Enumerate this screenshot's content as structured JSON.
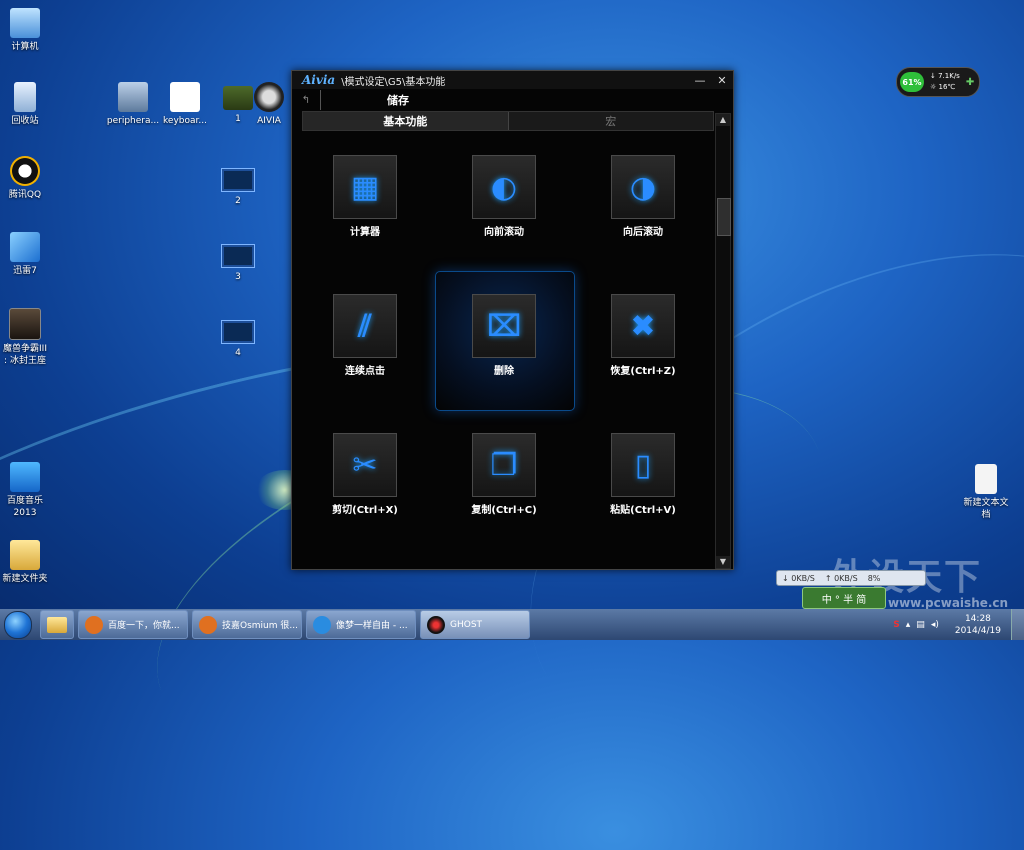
{
  "desktop_icons": [
    {
      "label": "计算机"
    },
    {
      "label": "回收站"
    },
    {
      "label": "腾讯QQ"
    },
    {
      "label": "迅雷7"
    },
    {
      "label": "魔兽争霸III\n: 冰封王座"
    },
    {
      "label": "百度音乐\n2013"
    },
    {
      "label": "新建文件夹"
    },
    {
      "label": "periphera..."
    },
    {
      "label": "keyboar..."
    },
    {
      "label": "1"
    },
    {
      "label": "AIVIA"
    },
    {
      "label": "2"
    },
    {
      "label": "3"
    },
    {
      "label": "4"
    },
    {
      "label": "新建文本文\n档"
    }
  ],
  "window": {
    "brand": "Aivia",
    "path": "\\模式设定\\G5\\基本功能",
    "minimize": "—",
    "close": "✕",
    "back": "↰",
    "save_label": "储存",
    "tabs": [
      {
        "label": "基本功能"
      },
      {
        "label": "宏"
      }
    ],
    "functions": [
      {
        "label": "计算器",
        "icon": "calculator-icon",
        "glyph": "▦"
      },
      {
        "label": "向前滚动",
        "icon": "scroll-forward-icon",
        "glyph": "◐"
      },
      {
        "label": "向后滚动",
        "icon": "scroll-backward-icon",
        "glyph": "◑"
      },
      {
        "label": "连续点击",
        "icon": "continuous-click-icon",
        "glyph": "⫽"
      },
      {
        "label": "删除",
        "icon": "trash-icon",
        "glyph": "⌧"
      },
      {
        "label": "恢复(Ctrl+Z)",
        "icon": "undo-icon",
        "glyph": "✖"
      },
      {
        "label": "剪切(Ctrl+X)",
        "icon": "scissors-icon",
        "glyph": "✂"
      },
      {
        "label": "复制(Ctrl+C)",
        "icon": "copy-icon",
        "glyph": "❐"
      },
      {
        "label": "粘贴(Ctrl+V)",
        "icon": "paste-icon",
        "glyph": "▯"
      }
    ]
  },
  "gadget": {
    "battery": "61%",
    "net": "↓ 7.1K/s",
    "temp": "☼ 16℃",
    "plus": "✚"
  },
  "netmonitor": {
    "down": "↓ 0KB/S",
    "up": "↑ 0KB/S",
    "cpu": "8%"
  },
  "ime": {
    "label": "中 ° 半 简"
  },
  "watermark": {
    "text": "外设天下",
    "url": "www.pcwaishe.cn"
  },
  "taskbar": {
    "items": [
      {
        "label": "百度一下，你就..."
      },
      {
        "label": "技嘉Osmium 很..."
      },
      {
        "label": "像梦一样自由 - ..."
      },
      {
        "label": "GHOST"
      }
    ],
    "time": "14:28",
    "date": "2014/4/19"
  },
  "colors": {
    "accent": "#2a8cff",
    "window_bg": "#050505",
    "desktop": "#1e64c4"
  }
}
